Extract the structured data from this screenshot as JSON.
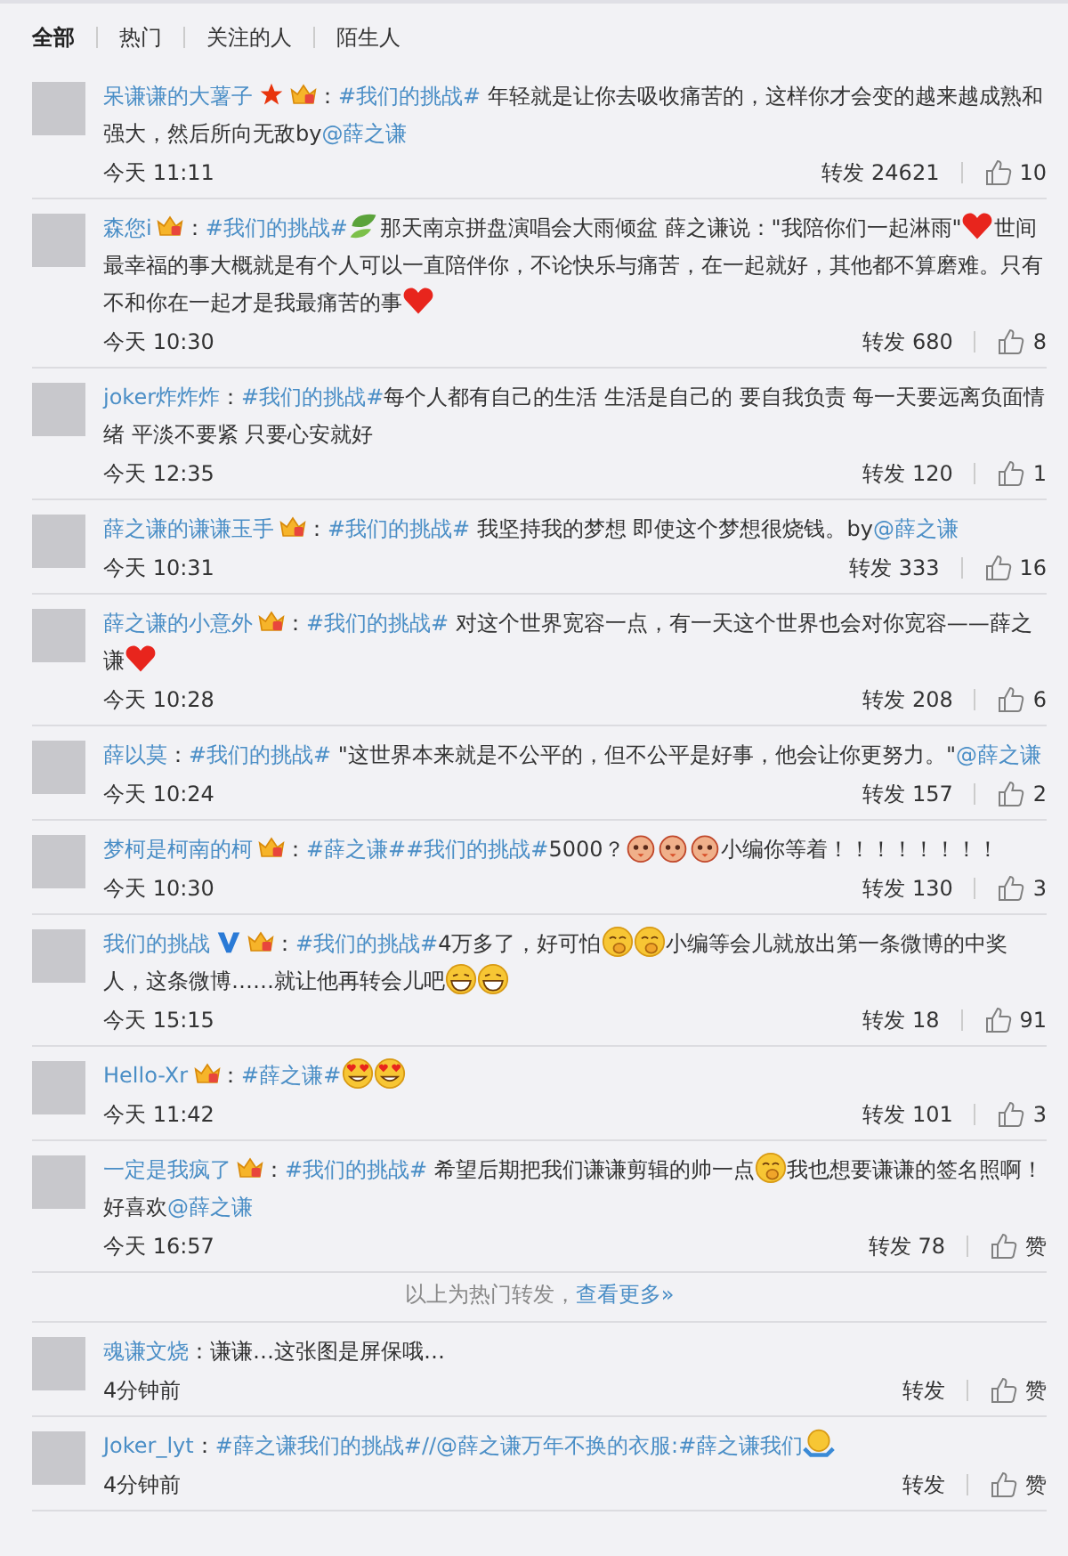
{
  "tabs": [
    {
      "label": "全部",
      "selected": true
    },
    {
      "label": "热门",
      "selected": false
    },
    {
      "label": "关注的人",
      "selected": false
    },
    {
      "label": "陌生人",
      "selected": false
    }
  ],
  "posts": [
    {
      "user": "呆谦谦的大薯子",
      "badges": [
        {
          "kind": "star"
        },
        {
          "kind": "crown"
        }
      ],
      "segments": [
        {
          "kind": "text",
          "text": "："
        },
        {
          "kind": "link",
          "text": "#我们的挑战#"
        },
        {
          "kind": "text",
          "text": " 年轻就是让你去吸收痛苦的，这样你才会变的越来越成熟和强大，然后所向无敌by"
        },
        {
          "kind": "link",
          "text": "@薛之谦"
        }
      ],
      "time": "今天 11:11",
      "repost": "转发 24621",
      "like": "10"
    },
    {
      "user": "森您i",
      "badges": [
        {
          "kind": "crown"
        }
      ],
      "segments": [
        {
          "kind": "text",
          "text": "："
        },
        {
          "kind": "link",
          "text": "#我们的挑战#"
        },
        {
          "kind": "leaf"
        },
        {
          "kind": "text",
          "text": "那天南京拼盘演唱会大雨倾盆 薛之谦说：\"我陪你们一起淋雨\""
        },
        {
          "kind": "heart"
        },
        {
          "kind": "text",
          "text": "世间最幸福的事大概就是有个人可以一直陪伴你，不论快乐与痛苦，在一起就好，其他都不算磨难。只有不和你在一起才是我最痛苦的事"
        },
        {
          "kind": "heart"
        }
      ],
      "time": "今天 10:30",
      "repost": "转发 680",
      "like": "8"
    },
    {
      "user": "joker炸炸炸",
      "segments": [
        {
          "kind": "text",
          "text": "："
        },
        {
          "kind": "link",
          "text": "#我们的挑战#"
        },
        {
          "kind": "text",
          "text": "每个人都有自己的生活  生活是自己的  要自我负责  每一天要远离负面情绪 平淡不要紧 只要心安就好"
        }
      ],
      "time": "今天 12:35",
      "repost": "转发 120",
      "like": "1"
    },
    {
      "user": "薛之谦的谦谦玉手",
      "badges": [
        {
          "kind": "crown"
        }
      ],
      "segments": [
        {
          "kind": "text",
          "text": "："
        },
        {
          "kind": "link",
          "text": "#我们的挑战#"
        },
        {
          "kind": "text",
          "text": " 我坚持我的梦想 即使这个梦想很烧钱。by"
        },
        {
          "kind": "link",
          "text": "@薛之谦"
        }
      ],
      "time": "今天 10:31",
      "repost": "转发 333",
      "like": "16"
    },
    {
      "user": "薛之谦的小意外",
      "badges": [
        {
          "kind": "crown"
        }
      ],
      "segments": [
        {
          "kind": "text",
          "text": "："
        },
        {
          "kind": "link",
          "text": "#我们的挑战#"
        },
        {
          "kind": "text",
          "text": " 对这个世界宽容一点，有一天这个世界也会对你宽容——薛之谦"
        },
        {
          "kind": "heart"
        }
      ],
      "time": "今天 10:28",
      "repost": "转发 208",
      "like": "6"
    },
    {
      "user": "薛以莫",
      "segments": [
        {
          "kind": "text",
          "text": "："
        },
        {
          "kind": "link",
          "text": "#我们的挑战#"
        },
        {
          "kind": "text",
          "text": " \"这世界本来就是不公平的，但不公平是好事，他会让你更努力。\""
        },
        {
          "kind": "link",
          "text": "@薛之谦"
        }
      ],
      "time": "今天 10:24",
      "repost": "转发 157",
      "like": "2"
    },
    {
      "user": "梦柯是柯南的柯",
      "badges": [
        {
          "kind": "crown"
        }
      ],
      "segments": [
        {
          "kind": "text",
          "text": "："
        },
        {
          "kind": "link",
          "text": "#薛之谦##我们的挑战#"
        },
        {
          "kind": "text",
          "text": "5000？"
        },
        {
          "kind": "chick"
        },
        {
          "kind": "chick"
        },
        {
          "kind": "chick"
        },
        {
          "kind": "text",
          "text": "小编你等着！！！！！！！！"
        }
      ],
      "time": "今天 10:30",
      "repost": "转发 130",
      "like": "3"
    },
    {
      "user": "我们的挑战",
      "badges": [
        {
          "kind": "verified"
        },
        {
          "kind": "crown"
        }
      ],
      "segments": [
        {
          "kind": "text",
          "text": "："
        },
        {
          "kind": "link",
          "text": "#我们的挑战#"
        },
        {
          "kind": "text",
          "text": "4万多了，好可怕"
        },
        {
          "kind": "giggle"
        },
        {
          "kind": "giggle"
        },
        {
          "kind": "text",
          "text": "小编等会儿就放出第一条微博的中奖人，这条微博……就让他再转会儿吧"
        },
        {
          "kind": "grin"
        },
        {
          "kind": "grin"
        }
      ],
      "time": "今天 15:15",
      "repost": "转发 18",
      "like": "91"
    },
    {
      "user": "Hello-Xr",
      "badges": [
        {
          "kind": "crown"
        }
      ],
      "segments": [
        {
          "kind": "text",
          "text": "："
        },
        {
          "kind": "link",
          "text": "#薛之谦#"
        },
        {
          "kind": "hearteyes"
        },
        {
          "kind": "hearteyes"
        }
      ],
      "time": "今天 11:42",
      "repost": "转发 101",
      "like": "3"
    },
    {
      "user": "一定是我疯了",
      "badges": [
        {
          "kind": "crown"
        }
      ],
      "segments": [
        {
          "kind": "text",
          "text": "："
        },
        {
          "kind": "link",
          "text": "#我们的挑战#"
        },
        {
          "kind": "text",
          "text": "   希望后期把我们谦谦剪辑的帅一点"
        },
        {
          "kind": "giggle"
        },
        {
          "kind": "text",
          "text": "我也想要谦谦的签名照啊！好喜欢"
        },
        {
          "kind": "link",
          "text": "@薛之谦"
        }
      ],
      "time": "今天 16:57",
      "repost": "转发 78",
      "like": "赞"
    }
  ],
  "more": {
    "text": "以上为热门转发，",
    "link": "查看更多»"
  },
  "recent": [
    {
      "user": "魂谦文烧",
      "segments": [
        {
          "kind": "text",
          "text": "：谦谦…这张图是屏保哦…"
        }
      ],
      "time": "4分钟前",
      "repost": "转发",
      "like": "赞"
    },
    {
      "user": "Joker_lyt",
      "segments": [
        {
          "kind": "text",
          "text": "："
        },
        {
          "kind": "link",
          "text": "#薛之谦我们的挑战#//@薛之谦万年不换的衣服:#薛之谦我们"
        },
        {
          "kind": "shrug"
        }
      ],
      "time": "4分钟前",
      "repost": "转发",
      "like": "赞"
    }
  ]
}
